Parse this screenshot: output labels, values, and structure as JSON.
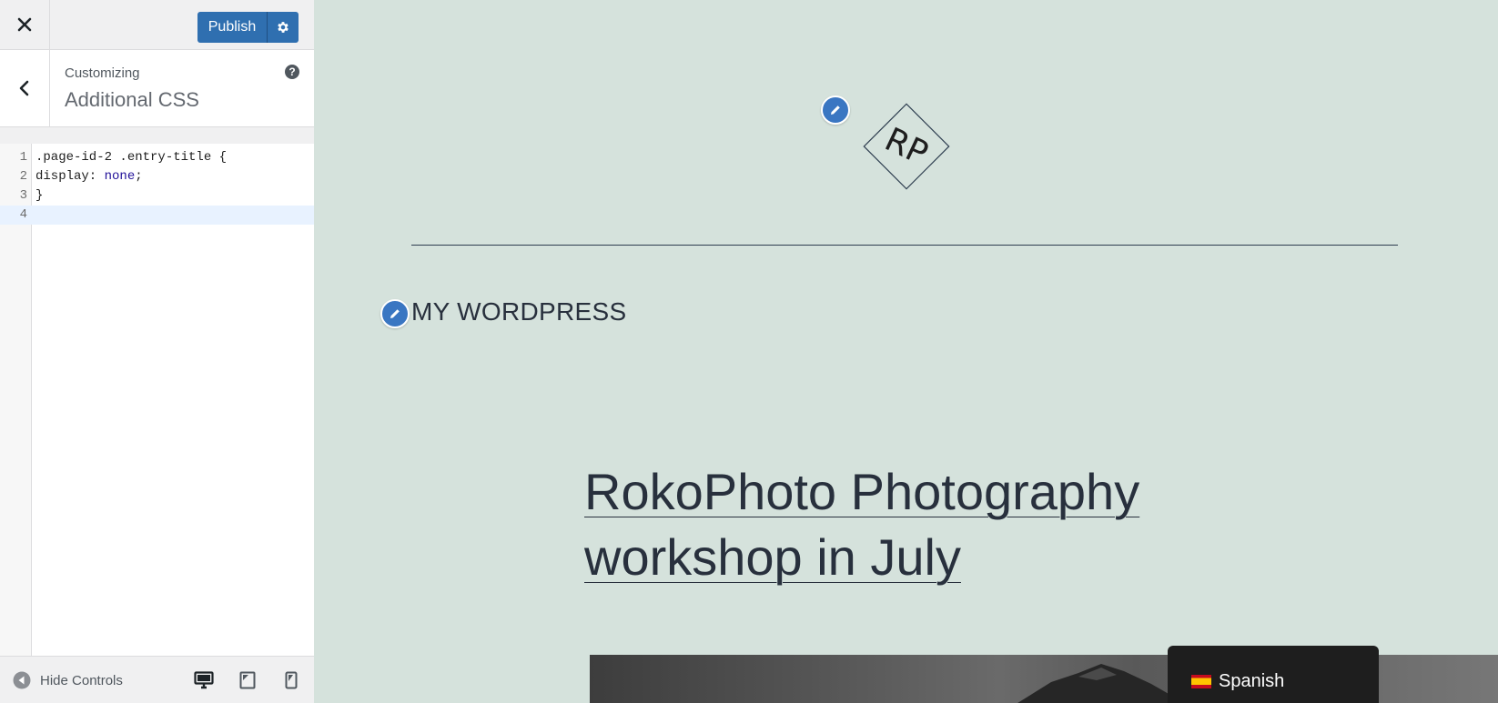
{
  "topbar": {
    "publish_label": "Publish"
  },
  "section": {
    "customizing_label": "Customizing",
    "title": "Additional CSS",
    "help_glyph": "?"
  },
  "editor": {
    "lines": [
      {
        "number": "1",
        "text": ".page-id-2 .entry-title {"
      },
      {
        "number": "2",
        "prop": "display: ",
        "value": "none",
        "end": ";"
      },
      {
        "number": "3",
        "text": "}"
      },
      {
        "number": "4",
        "text": ""
      }
    ],
    "active_line": 4
  },
  "footer": {
    "hide_controls_label": "Hide Controls",
    "devices": [
      "desktop-icon",
      "tablet-icon",
      "mobile-icon"
    ],
    "active_device": "desktop"
  },
  "preview": {
    "logo_text": "RP",
    "site_title": "MY WORDPRESS",
    "post_title_line1": "RokoPhoto Photography",
    "post_title_line2": "workshop in July",
    "language_label": "Spanish"
  },
  "colors": {
    "accent": "#2f6fb0",
    "preview_bg": "#d5e2dc",
    "text_dark": "#28303d",
    "edit_pencil": "#3a76c2"
  }
}
